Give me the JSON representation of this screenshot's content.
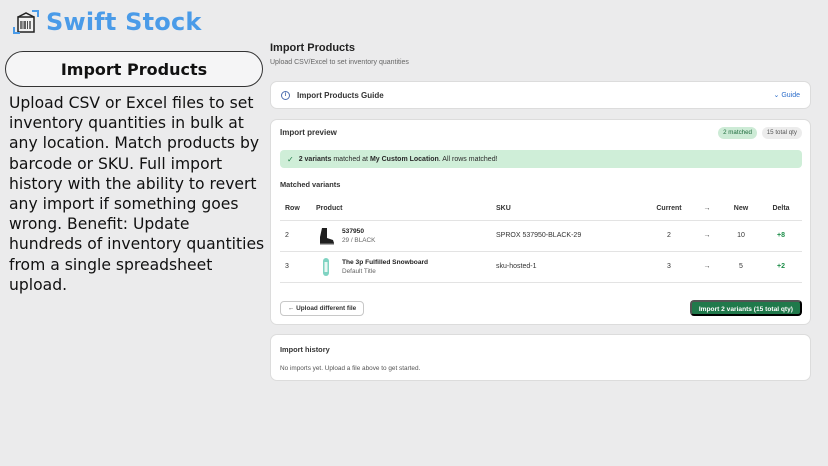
{
  "brand": {
    "name": "Swift Stock",
    "color": "#4a9be8",
    "logo_icon": "box-scan-icon"
  },
  "promo": {
    "title": "Import Products",
    "body": "Upload CSV or Excel files to set inventory quantities in bulk at any location. Match products by barcode or SKU. Full import history with the ability to revert any import if something goes wrong. Benefit: Update hundreds of inventory quantities from a single spreadsheet upload."
  },
  "page": {
    "title": "Import Products",
    "subtitle": "Upload CSV/Excel to set inventory quantities"
  },
  "guide": {
    "title": "Import Products Guide",
    "link": "Guide",
    "icon": "info-icon"
  },
  "preview": {
    "title": "Import preview",
    "badge_matched": "2 matched",
    "badge_total": "15 total qty",
    "banner_count": "2 variants",
    "banner_mid": "matched at",
    "banner_location": "My Custom Location",
    "banner_tail": ". All rows matched!",
    "matched_label": "Matched variants",
    "columns": [
      "Row",
      "Product",
      "SKU",
      "Current",
      "→",
      "New",
      "Delta"
    ],
    "rows": [
      {
        "row": "2",
        "name": "537950",
        "variant": "29 / BLACK",
        "sku": "SPROX 537950-BLACK-29",
        "current": "2",
        "arrow": "→",
        "new": "10",
        "delta": "+8"
      },
      {
        "row": "3",
        "name": "The 3p Fulfilled Snowboard",
        "variant": "Default Title",
        "sku": "sku-hosted-1",
        "current": "3",
        "arrow": "→",
        "new": "5",
        "delta": "+2"
      }
    ],
    "upload_button": "← Upload different file",
    "import_button": "Import 2 variants (15 total qty)",
    "accent": "#20794b"
  },
  "history": {
    "title": "Import history",
    "empty": "No imports yet. Upload a file above to get started."
  }
}
